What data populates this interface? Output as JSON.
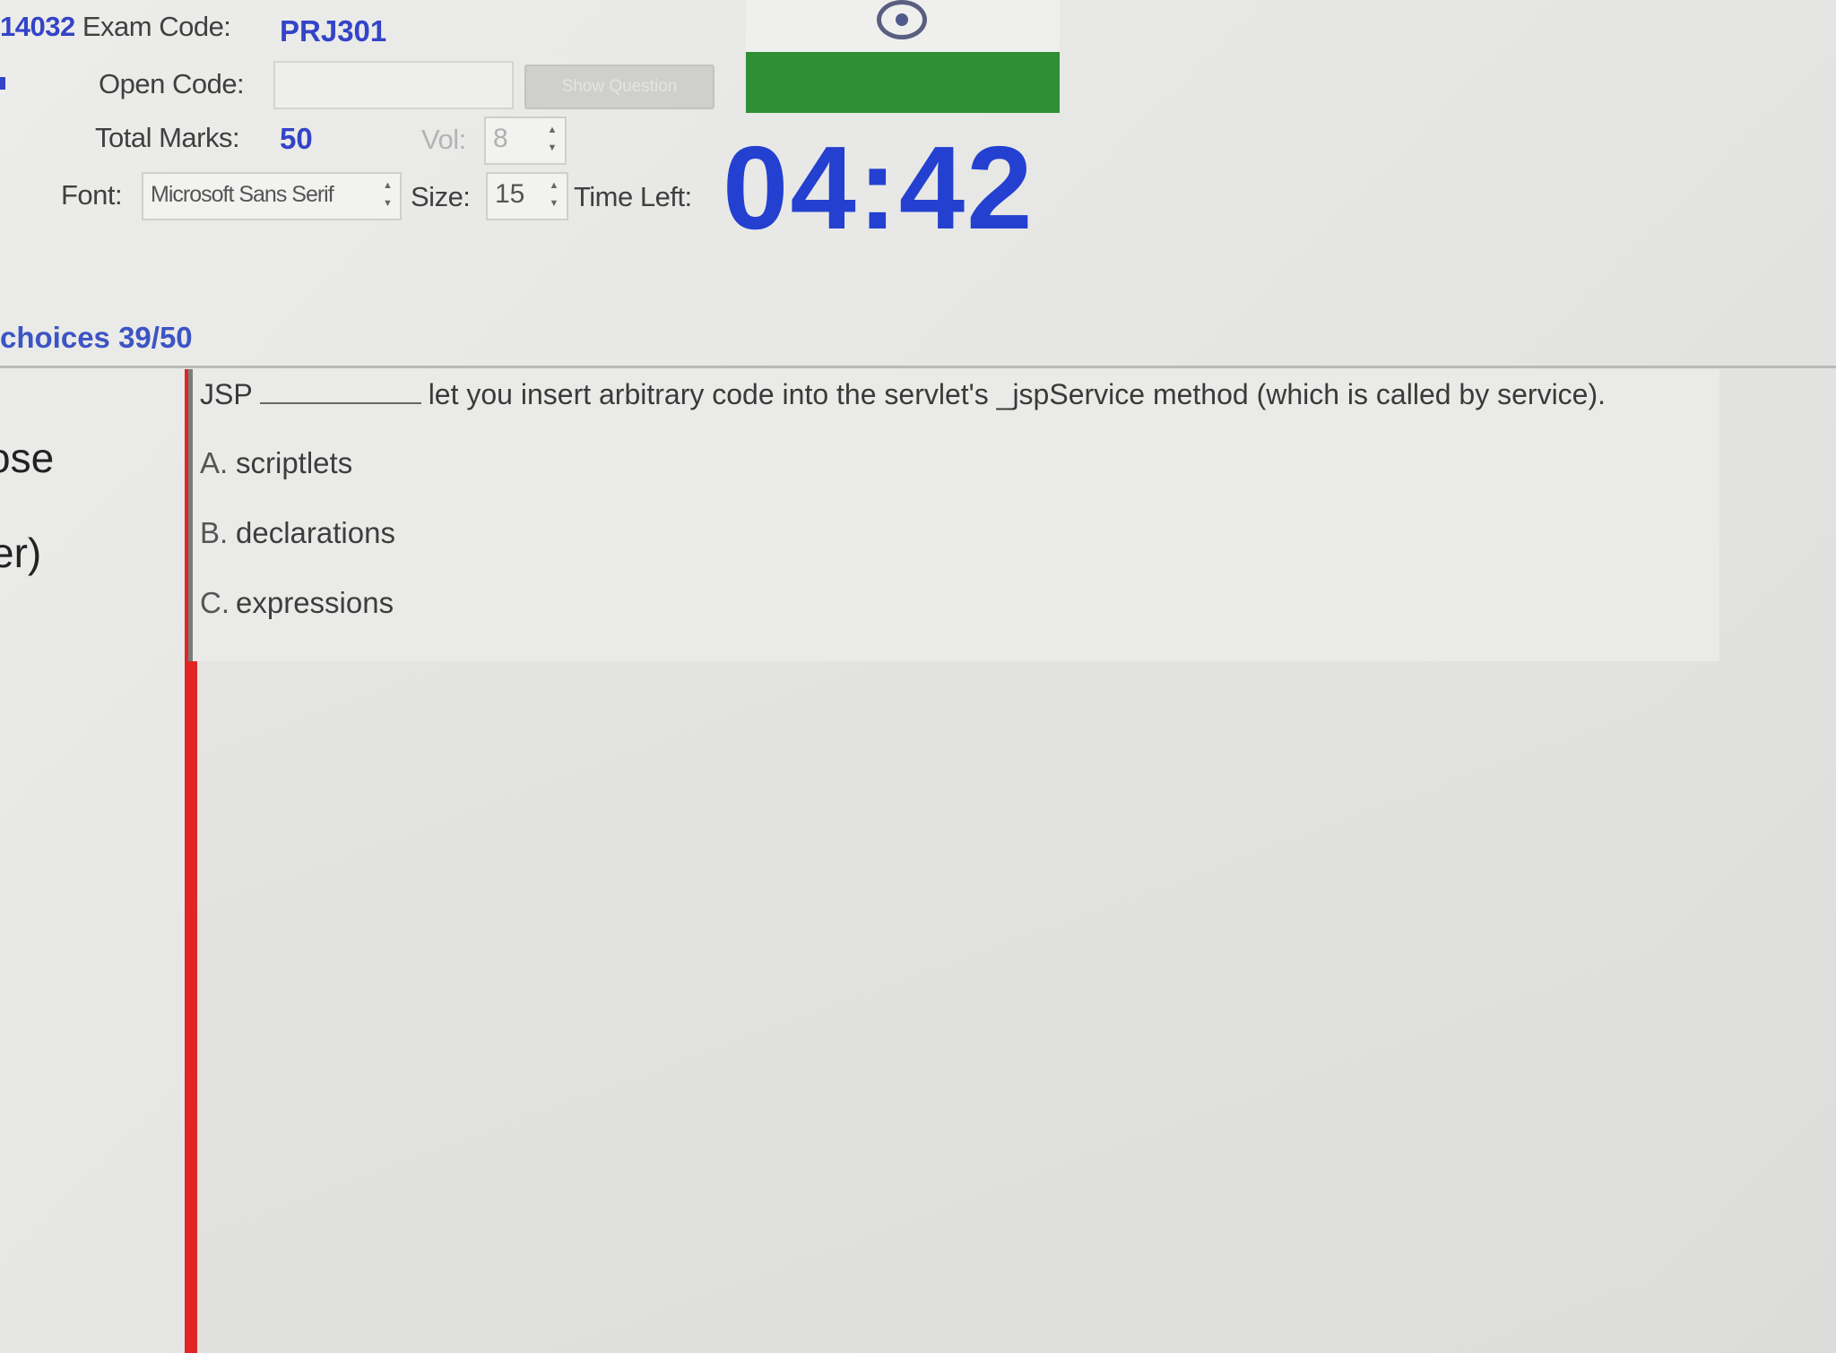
{
  "header": {
    "exam_id_fragment": "14032",
    "exam_code_label": "Exam Code:",
    "exam_code_value": "PRJ301",
    "open_code_label": "Open Code:",
    "open_code_value": "",
    "show_question_label": "Show Question",
    "total_marks_label": "Total Marks:",
    "total_marks_value": "50",
    "vol_label": "Vol:",
    "vol_value": "8",
    "font_label": "Font:",
    "font_value": "Microsoft Sans Serif",
    "size_label": "Size:",
    "size_value": "15",
    "time_left_label": "Time Left:",
    "time_left_value": "04:42"
  },
  "progress": {
    "choices_label": "choices 39/50"
  },
  "sidebar": {
    "fragment_1": "ose",
    "fragment_2": "er)"
  },
  "question": {
    "prefix": "JSP",
    "suffix": "let you insert arbitrary code into the servlet's _jspService method (which is called by service).",
    "options": [
      {
        "letter": "A.",
        "text": "scriptlets"
      },
      {
        "letter": "B.",
        "text": "declarations"
      },
      {
        "letter": "C.",
        "text": "expressions"
      }
    ]
  },
  "colors": {
    "accent_blue": "#2340d0",
    "flag_green": "#2e8f34",
    "red_bar": "#e12424"
  }
}
